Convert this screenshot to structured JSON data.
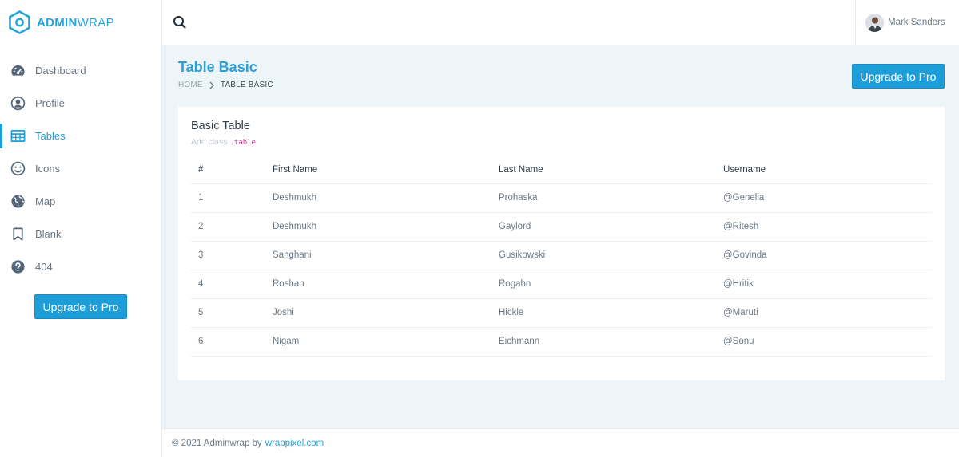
{
  "brand": {
    "name_bold": "ADMIN",
    "name_light": "WRAP",
    "accent": "#1e9ed8"
  },
  "sidebar": {
    "items": [
      {
        "label": "Dashboard",
        "icon": "dashboard-icon",
        "active": false
      },
      {
        "label": "Profile",
        "icon": "profile-icon",
        "active": false
      },
      {
        "label": "Tables",
        "icon": "table-icon",
        "active": true
      },
      {
        "label": "Icons",
        "icon": "smile-icon",
        "active": false
      },
      {
        "label": "Map",
        "icon": "globe-icon",
        "active": false
      },
      {
        "label": "Blank",
        "icon": "bookmark-icon",
        "active": false
      },
      {
        "label": "404",
        "icon": "question-icon",
        "active": false
      }
    ],
    "upgrade_label": "Upgrade to Pro"
  },
  "topbar": {
    "user_name": "Mark Sanders",
    "search_icon": "search-icon"
  },
  "header": {
    "title": "Table Basic",
    "breadcrumb": {
      "home": "HOME",
      "current": "TABLE BASIC"
    },
    "upgrade_label": "Upgrade to Pro"
  },
  "card": {
    "title": "Basic Table",
    "subtitle_prefix": "Add class",
    "subtitle_code": ".table",
    "columns": [
      "#",
      "First Name",
      "Last Name",
      "Username"
    ],
    "rows": [
      [
        "1",
        "Deshmukh",
        "Prohaska",
        "@Genelia"
      ],
      [
        "2",
        "Deshmukh",
        "Gaylord",
        "@Ritesh"
      ],
      [
        "3",
        "Sanghani",
        "Gusikowski",
        "@Govinda"
      ],
      [
        "4",
        "Roshan",
        "Rogahn",
        "@Hritik"
      ],
      [
        "5",
        "Joshi",
        "Hickle",
        "@Maruti"
      ],
      [
        "6",
        "Nigam",
        "Eichmann",
        "@Sonu"
      ]
    ]
  },
  "footer": {
    "text": "© 2021 Adminwrap by",
    "link": "wrappixel.com"
  }
}
